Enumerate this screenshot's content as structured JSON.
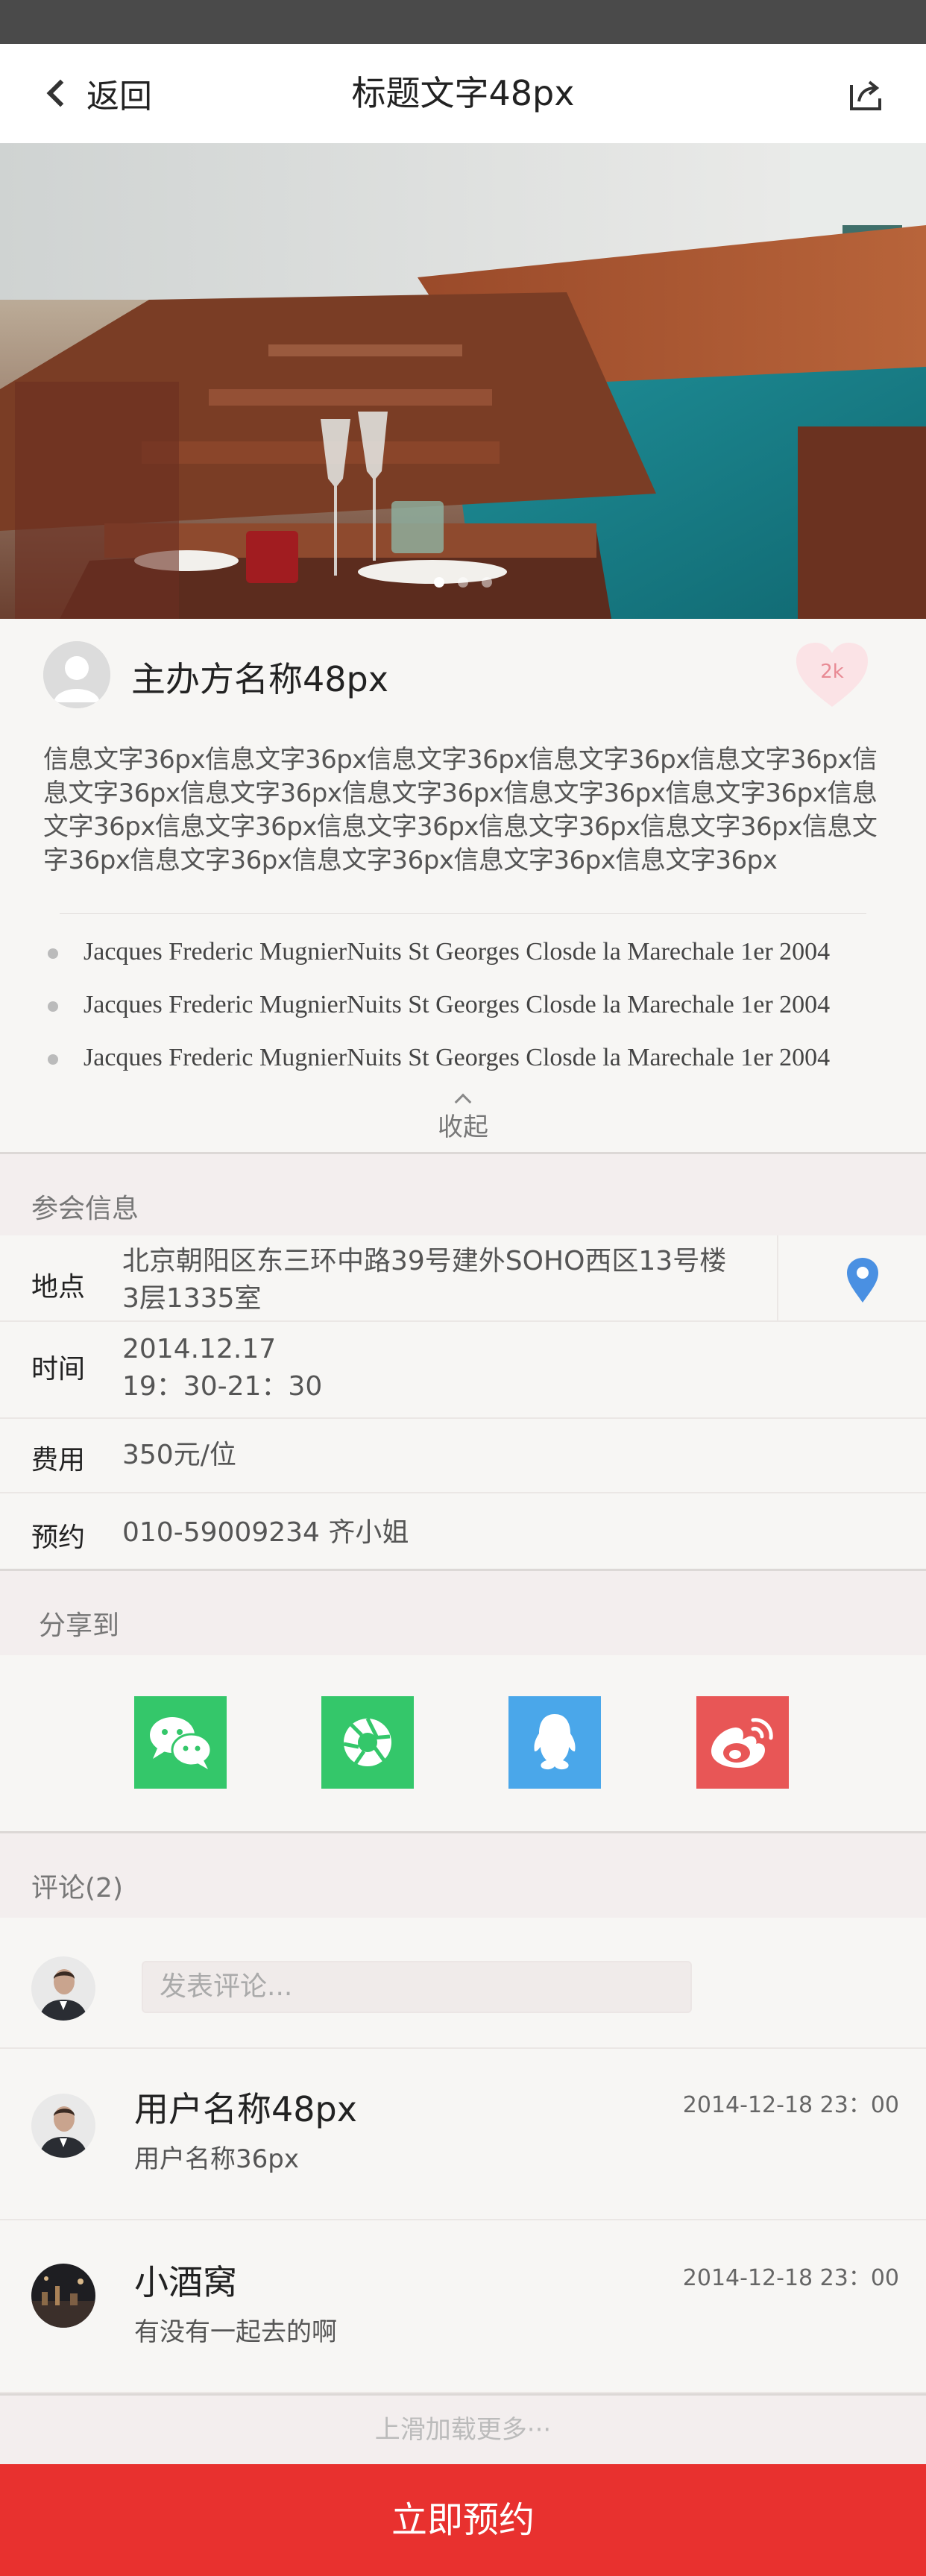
{
  "nav": {
    "back_label": "返回",
    "title": "标题文字48px"
  },
  "hero": {
    "slide_count": 3,
    "active_index": 0
  },
  "host": {
    "name": "主办方名称48px",
    "likes": "2k",
    "description": "信息文字36px信息文字36px信息文字36px信息文字36px信息文字36px信息文字36px信息文字36px信息文字36px信息文字36px信息文字36px信息文字36px信息文字36px信息文字36px信息文字36px信息文字36px信息文字36px信息文字36px信息文字36px信息文字36px信息文字36px",
    "wines": [
      "Jacques Frederic MugnierNuits St Georges Closde la Marechale 1er 2004",
      "Jacques Frederic MugnierNuits St Georges Closde la Marechale 1er 2004",
      "Jacques Frederic MugnierNuits St Georges Closde la Marechale 1er 2004"
    ],
    "collapse_label": "收起"
  },
  "meeting": {
    "section_title": "参会信息",
    "location_label": "地点",
    "location_line1": "北京朝阳区东三环中路39号建外SOHO西区13号楼",
    "location_line2": "3层1335室",
    "time_label": "时间",
    "time_date": "2014.12.17",
    "time_range": "19：30-21：30",
    "fee_label": "费用",
    "fee_value": "350元/位",
    "booking_label": "预约",
    "booking_value": "010-59009234 齐小姐"
  },
  "share": {
    "section_title": "分享到",
    "targets": [
      "wechat-icon",
      "moments-icon",
      "qq-icon",
      "weibo-icon"
    ],
    "colors": {
      "wechat": "#34c76a",
      "moments": "#34c76a",
      "qq": "#4aa7ea",
      "weibo": "#e85656"
    }
  },
  "comments": {
    "section_title": "评论(2)",
    "input_placeholder": "发表评论...",
    "items": [
      {
        "name": "用户名称48px",
        "time": "2014-12-18 23：00",
        "text": "用户名称36px"
      },
      {
        "name": "小酒窝",
        "time": "2014-12-18 23：00",
        "text": "有没有一起去的啊"
      }
    ],
    "load_more": "上滑加载更多···"
  },
  "footer": {
    "reserve_label": "立即预约"
  },
  "colors": {
    "accent_red": "#e8312f",
    "pin_blue": "#4a90e2"
  }
}
